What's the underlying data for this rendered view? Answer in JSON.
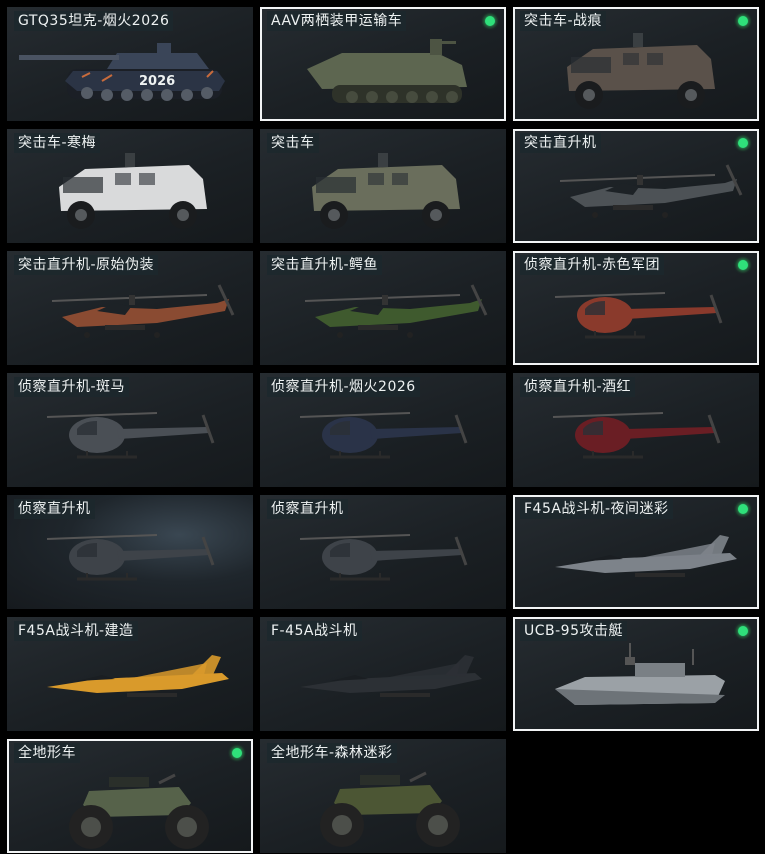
{
  "colors": {
    "selected_border": "#f2f4f5",
    "equipped_dot": "#2fe07a",
    "card_bg": "#1b2024",
    "label_bg": "#1c282d"
  },
  "vehicles": [
    {
      "name": "GTQ35坦克-烟火2026",
      "selected": false,
      "equipped": false,
      "icon": "tank-icon",
      "decal": "2026"
    },
    {
      "name": "AAV两栖装甲运输车",
      "selected": true,
      "equipped": true,
      "icon": "amphibious-apc-icon"
    },
    {
      "name": "突击车-战痕",
      "selected": true,
      "equipped": true,
      "icon": "armored-truck-icon"
    },
    {
      "name": "突击车-寒梅",
      "selected": false,
      "equipped": false,
      "icon": "armored-truck-icon"
    },
    {
      "name": "突击车",
      "selected": false,
      "equipped": false,
      "icon": "armored-truck-icon"
    },
    {
      "name": "突击直升机",
      "selected": true,
      "equipped": true,
      "icon": "attack-helicopter-icon"
    },
    {
      "name": "突击直升机-原始伪装",
      "selected": false,
      "equipped": false,
      "icon": "attack-helicopter-icon"
    },
    {
      "name": "突击直升机-鳄鱼",
      "selected": false,
      "equipped": false,
      "icon": "attack-helicopter-icon"
    },
    {
      "name": "侦察直升机-赤色军团",
      "selected": true,
      "equipped": true,
      "icon": "scout-helicopter-icon"
    },
    {
      "name": "侦察直升机-斑马",
      "selected": false,
      "equipped": false,
      "icon": "scout-helicopter-icon"
    },
    {
      "name": "侦察直升机-烟火2026",
      "selected": false,
      "equipped": false,
      "icon": "scout-helicopter-icon"
    },
    {
      "name": "侦察直升机-酒红",
      "selected": false,
      "equipped": false,
      "icon": "scout-helicopter-icon"
    },
    {
      "name": "侦察直升机",
      "selected": false,
      "equipped": false,
      "icon": "scout-helicopter-icon"
    },
    {
      "name": "侦察直升机",
      "selected": false,
      "equipped": false,
      "icon": "scout-helicopter-icon"
    },
    {
      "name": "F45A战斗机-夜间迷彩",
      "selected": true,
      "equipped": true,
      "icon": "fighter-jet-icon"
    },
    {
      "name": "F45A战斗机-建造",
      "selected": false,
      "equipped": false,
      "icon": "fighter-jet-icon"
    },
    {
      "name": "F-45A战斗机",
      "selected": false,
      "equipped": false,
      "icon": "fighter-jet-icon"
    },
    {
      "name": "UCB-95攻击艇",
      "selected": true,
      "equipped": true,
      "icon": "attack-boat-icon"
    },
    {
      "name": "全地形车",
      "selected": true,
      "equipped": true,
      "icon": "atv-icon"
    },
    {
      "name": "全地形车-森林迷彩",
      "selected": false,
      "equipped": false,
      "icon": "atv-icon"
    }
  ]
}
